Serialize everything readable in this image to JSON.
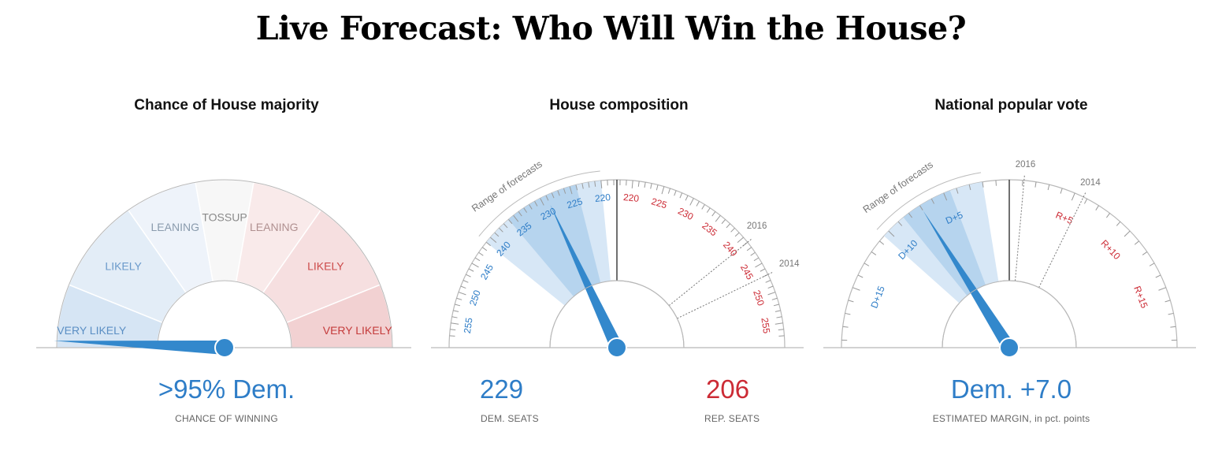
{
  "page": {
    "title": "Live Forecast: Who Will Win the House?"
  },
  "colors": {
    "dem": "#2e7dc7",
    "rep": "#cc2b35",
    "needle": "#3388cc",
    "band": "#b5d3ee"
  },
  "chart_data": [
    {
      "type": "gauge",
      "title": "Chance of House majority",
      "segments": [
        {
          "label": "VERY LIKELY",
          "party": "dem"
        },
        {
          "label": "LIKELY",
          "party": "dem"
        },
        {
          "label": "LEANING",
          "party": "dem"
        },
        {
          "label": "TOSSUP",
          "party": "none"
        },
        {
          "label": "LEANING",
          "party": "rep"
        },
        {
          "label": "LIKELY",
          "party": "rep"
        },
        {
          "label": "VERY LIKELY",
          "party": "rep"
        }
      ],
      "needle_dem_probability": 0.97,
      "value_label": ">95% Dem.",
      "value_caption": "CHANCE OF WINNING"
    },
    {
      "type": "gauge",
      "title": "House composition",
      "range_label": "Range of forecasts",
      "dem_ticks": [
        "255",
        "250",
        "245",
        "240",
        "235",
        "230",
        "225",
        "220"
      ],
      "rep_ticks": [
        "220",
        "225",
        "230",
        "235",
        "240",
        "245",
        "250",
        "255"
      ],
      "dem_seats": 229,
      "rep_seats": 206,
      "forecast_inner_range": [
        224,
        236
      ],
      "forecast_outer_range": [
        220,
        241
      ],
      "markers": [
        {
          "label": "2016",
          "dem_seats": 194
        },
        {
          "label": "2014",
          "dem_seats": 188
        }
      ],
      "dem_value": "229",
      "dem_caption": "DEM. SEATS",
      "rep_value": "206",
      "rep_caption": "REP. SEATS"
    },
    {
      "type": "gauge",
      "title": "National popular vote",
      "range_label": "Range of forecasts",
      "dem_ticks": [
        "D+15",
        "D+10",
        "D+5"
      ],
      "rep_ticks": [
        "R+5",
        "R+10",
        "R+15"
      ],
      "estimated_margin": 7.0,
      "forecast_inner_range": [
        4.5,
        8.5
      ],
      "forecast_outer_range": [
        2.0,
        10.5
      ],
      "markers": [
        {
          "label": "2016",
          "margin": -1.1
        },
        {
          "label": "2014",
          "margin": -5.7
        }
      ],
      "value_label": "Dem. +7.0",
      "value_caption": "ESTIMATED MARGIN, in pct. points"
    }
  ]
}
